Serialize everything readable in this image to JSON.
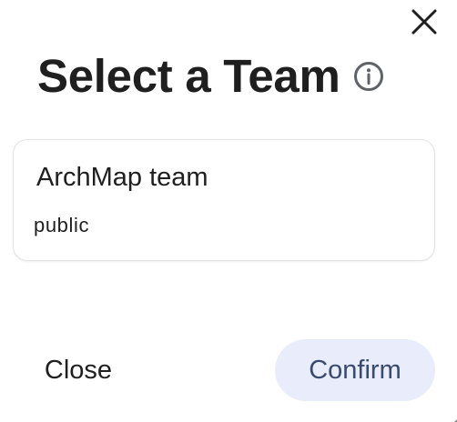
{
  "dialog": {
    "title": "Select a Team",
    "close_icon": "close-icon",
    "info_icon": "info-icon"
  },
  "teams": [
    {
      "name": "ArchMap team",
      "visibility": "public"
    }
  ],
  "actions": {
    "close_label": "Close",
    "confirm_label": "Confirm"
  },
  "colors": {
    "confirm_bg": "#e8ecfb",
    "confirm_text": "#3a4a6e",
    "text": "#1f1f1f",
    "card_border": "#e3e3e3"
  }
}
